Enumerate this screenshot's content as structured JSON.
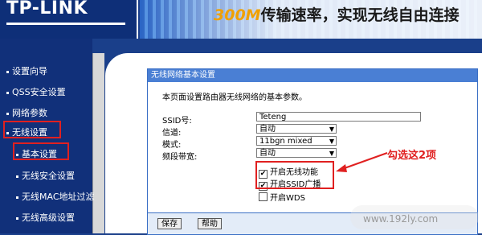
{
  "header": {
    "logo": "TP-LINK",
    "banner_speed": "300M",
    "banner_rest": "传输速率，实现无线自由连接"
  },
  "sidebar": {
    "items": [
      {
        "label": "设置向导"
      },
      {
        "label": "QSS安全设置"
      },
      {
        "label": "网络参数"
      },
      {
        "label": "无线设置"
      },
      {
        "label": "基本设置"
      },
      {
        "label": "无线安全设置"
      },
      {
        "label": "无线MAC地址过滤"
      },
      {
        "label": "无线高级设置"
      }
    ]
  },
  "panel": {
    "title": "无线网络基本设置",
    "description": "本页面设置路由器无线网络的基本参数。",
    "ssid_label": "SSID号:",
    "ssid_value": "Teteng",
    "channel_label": "信道:",
    "channel_value": "自动",
    "mode_label": "模式:",
    "mode_value": "11bgn mixed",
    "bandwidth_label": "频段带宽:",
    "bandwidth_value": "自动",
    "enable_wireless_label": "开启无线功能",
    "enable_ssid_broadcast_label": "开启SSID广播",
    "enable_wds_label": "开启WDS",
    "save_label": "保存",
    "help_label": "帮助"
  },
  "annotation": {
    "text": "勾选这2项",
    "color": "#e02020"
  },
  "watermark": "www.192ly.com"
}
